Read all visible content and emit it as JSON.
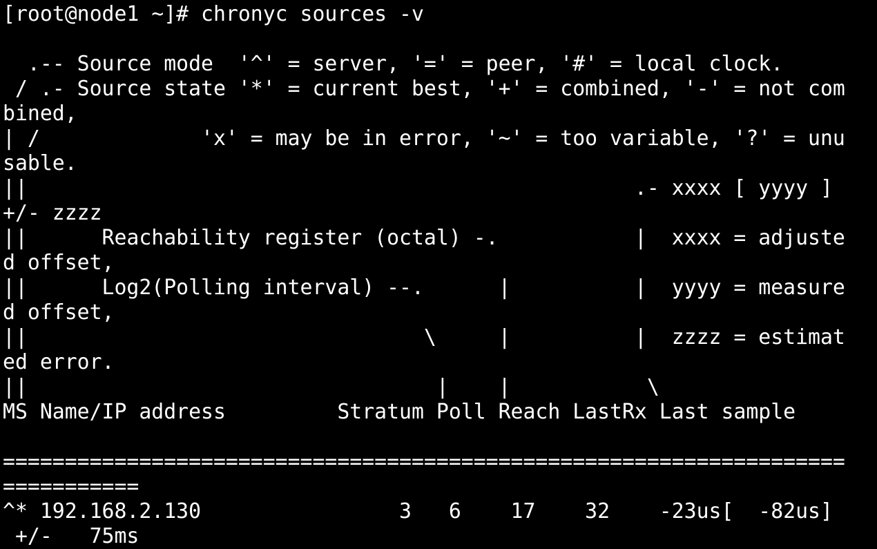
{
  "terminal": {
    "prompt": "[root@node1 ~]# chronyc sources -v",
    "legend": [
      "  .-- Source mode  '^' = server, '=' = peer, '#' = local clock.",
      " / .- Source state '*' = current best, '+' = combined, '-' = not com",
      "bined,",
      "| /             'x' = may be in error, '~' = too variable, '?' = unu",
      "sable.",
      "||                                                 .- xxxx [ yyyy ]",
      "+/- zzzz",
      "||      Reachability register (octal) -.           |  xxxx = adjuste",
      "d offset,",
      "||      Log2(Polling interval) --.      |          |  yyyy = measure",
      "d offset,",
      "||                                \\     |          |  zzzz = estimat",
      "ed error.",
      "||                                 |    |           \\"
    ],
    "header": "MS Name/IP address         Stratum Poll Reach LastRx Last sample",
    "separator": [
      "====================================================================",
      "==========="
    ],
    "rows": [
      {
        "line1": "^* 192.168.2.130                3   6    17    32    -23us[  -82us]",
        "line2": " +/-   75ms"
      }
    ]
  }
}
